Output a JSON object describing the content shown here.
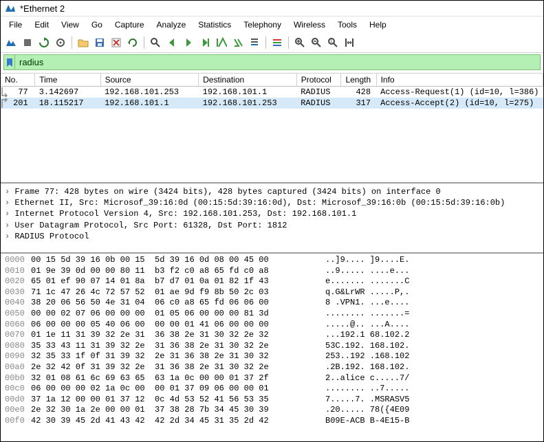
{
  "title": "*Ethernet 2",
  "menu": [
    "File",
    "Edit",
    "View",
    "Go",
    "Capture",
    "Analyze",
    "Statistics",
    "Telephony",
    "Wireless",
    "Tools",
    "Help"
  ],
  "filter": "radius",
  "columns": [
    "No.",
    "Time",
    "Source",
    "Destination",
    "Protocol",
    "Length",
    "Info"
  ],
  "packets": [
    {
      "no": "77",
      "time": "3.142697",
      "src": "192.168.101.253",
      "dst": "192.168.101.1",
      "proto": "RADIUS",
      "len": "428",
      "info": "Access-Request(1) (id=10, l=386)",
      "sel": false
    },
    {
      "no": "201",
      "time": "18.115217",
      "src": "192.168.101.1",
      "dst": "192.168.101.253",
      "proto": "RADIUS",
      "len": "317",
      "info": "Access-Accept(2) (id=10, l=275)",
      "sel": true
    }
  ],
  "details": [
    "Frame 77: 428 bytes on wire (3424 bits), 428 bytes captured (3424 bits) on interface 0",
    "Ethernet II, Src: Microsof_39:16:0d (00:15:5d:39:16:0d), Dst: Microsof_39:16:0b (00:15:5d:39:16:0b)",
    "Internet Protocol Version 4, Src: 192.168.101.253, Dst: 192.168.101.1",
    "User Datagram Protocol, Src Port: 61328, Dst Port: 1812",
    "RADIUS Protocol"
  ],
  "hex": [
    {
      "off": "0000",
      "b": "00 15 5d 39 16 0b 00 15  5d 39 16 0d 08 00 45 00",
      "a": "..]9.... ]9....E."
    },
    {
      "off": "0010",
      "b": "01 9e 39 0d 00 00 80 11  b3 f2 c0 a8 65 fd c0 a8",
      "a": "..9..... ....e..."
    },
    {
      "off": "0020",
      "b": "65 01 ef 90 07 14 01 8a  b7 d7 01 0a 01 82 1f 43",
      "a": "e....... .......C"
    },
    {
      "off": "0030",
      "b": "71 1c 47 26 4c 72 57 52  01 ae 9d f9 8b 50 2c 03",
      "a": "q.G&LrWR .....P,."
    },
    {
      "off": "0040",
      "b": "38 20 06 56 50 4e 31 04  06 c0 a8 65 fd 06 06 00",
      "a": "8 .VPN1. ...e...."
    },
    {
      "off": "0050",
      "b": "00 00 02 07 06 00 00 00  01 05 06 00 00 00 81 3d",
      "a": "........ .......="
    },
    {
      "off": "0060",
      "b": "06 00 00 00 05 40 06 00  00 00 01 41 06 00 00 00",
      "a": ".....@.. ...A...."
    },
    {
      "off": "0070",
      "b": "01 1e 11 31 39 32 2e 31  36 38 2e 31 30 32 2e 32",
      "a": "...192.1 68.102.2"
    },
    {
      "off": "0080",
      "b": "35 33 43 11 31 39 32 2e  31 36 38 2e 31 30 32 2e",
      "a": "53C.192. 168.102."
    },
    {
      "off": "0090",
      "b": "32 35 33 1f 0f 31 39 32  2e 31 36 38 2e 31 30 32",
      "a": "253..192 .168.102"
    },
    {
      "off": "00a0",
      "b": "2e 32 42 0f 31 39 32 2e  31 36 38 2e 31 30 32 2e",
      "a": ".2B.192. 168.102."
    },
    {
      "off": "00b0",
      "b": "32 01 08 61 6c 69 63 65  63 1a 0c 00 00 01 37 2f",
      "a": "2..alice c.....7/"
    },
    {
      "off": "00c0",
      "b": "06 00 00 00 02 1a 0c 00  00 01 37 09 06 00 00 01",
      "a": "........ ..7....."
    },
    {
      "off": "00d0",
      "b": "37 1a 12 00 00 01 37 12  0c 4d 53 52 41 56 53 35",
      "a": "7.....7. .MSRASV5"
    },
    {
      "off": "00e0",
      "b": "2e 32 30 1a 2e 00 00 01  37 38 28 7b 34 45 30 39",
      "a": ".20..... 78({4E09"
    },
    {
      "off": "00f0",
      "b": "42 30 39 45 2d 41 43 42  42 2d 34 45 31 35 2d 42",
      "a": "B09E-ACB B-4E15-B"
    }
  ],
  "icons": {
    "shark": "shark-icon",
    "stop": "stop-icon",
    "restart": "restart-icon",
    "options": "options-icon",
    "open": "open-folder-icon",
    "save": "save-icon",
    "close": "close-file-icon",
    "reload": "reload-icon",
    "find": "find-icon",
    "prev": "go-prev-icon",
    "next": "go-next-icon",
    "jump": "go-jump-icon",
    "first": "go-first-icon",
    "last": "go-last-icon",
    "autoscroll": "autoscroll-icon",
    "colorize": "colorize-icon",
    "zoomin": "zoom-in-icon",
    "zoomout": "zoom-out-icon",
    "zoom1": "zoom-reset-icon",
    "resize": "resize-cols-icon"
  }
}
